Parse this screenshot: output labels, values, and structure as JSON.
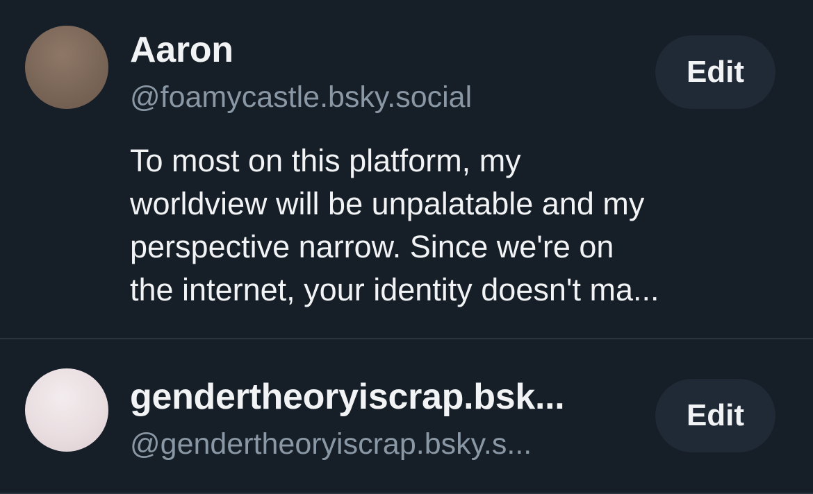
{
  "profiles": [
    {
      "display_name": "Aaron",
      "handle": "@foamycastle.bsky.social",
      "button_label": "Edit",
      "bio_lines": [
        "To most on this platform, my",
        "worldview will be unpalatable and my",
        "perspective narrow. Since we're on",
        "the internet, your identity doesn't ma..."
      ]
    },
    {
      "display_name": "gendertheoryiscrap.bsk...",
      "handle": "@gendertheoryiscrap.bsky.s...",
      "button_label": "Edit"
    }
  ],
  "colors": {
    "background": "#161e27",
    "text_primary": "#f1f3f5",
    "text_secondary": "#8a97a5",
    "button_bg": "#1f2a36",
    "divider": "#2b3540"
  }
}
